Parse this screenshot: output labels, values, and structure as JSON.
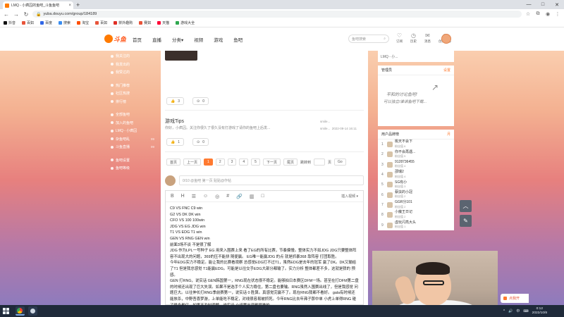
{
  "browser": {
    "tab_title": "LMQ - 小疯囚的鱼吧_斗鱼鱼吧",
    "close_glyph": "×",
    "new_tab_glyph": "+",
    "window_controls": [
      "—",
      "□",
      "✕"
    ],
    "url": "yuba.douyu.com/group/184189",
    "bookmarks": [
      {
        "label": "抖音",
        "color": "#111111"
      },
      {
        "label": "百如",
        "color": "#e8543a"
      },
      {
        "label": "百度",
        "color": "#3066e6"
      },
      {
        "label": "搜索",
        "color": "#3a8df0"
      },
      {
        "label": "淘宝",
        "color": "#ff5000"
      },
      {
        "label": "百如",
        "color": "#e8543a"
      },
      {
        "label": "拼外趣购",
        "color": "#e02e24"
      },
      {
        "label": "赛如",
        "color": "#e8543a"
      },
      {
        "label": "天猫",
        "color": "#ff0036"
      },
      {
        "label": "游戏大全",
        "color": "#2fa84f"
      }
    ]
  },
  "site": {
    "logo_text": "斗鱼",
    "nav": [
      "首页",
      "直播",
      "分类▾",
      "视频",
      "游戏",
      "鱼吧"
    ],
    "search_placeholder": "鱼吧搜索",
    "search_icon": "⌕",
    "header_icons": [
      {
        "glyph": "♡",
        "label": "订阅"
      },
      {
        "glyph": "◷",
        "label": "历史"
      },
      {
        "glyph": "✉",
        "label": "消息"
      },
      {
        "glyph": "☺",
        "label": "创作中心"
      }
    ]
  },
  "left_nav": {
    "group1": [
      "我关注的",
      "我发出的",
      "我赞过的"
    ],
    "group2": [
      "热门推荐",
      "社区热搜",
      "排行榜"
    ],
    "group3": [
      {
        "label": "全部鱼吧",
        "count": ""
      },
      {
        "label": "加入的鱼吧",
        "count": ""
      },
      {
        "label": "LMQ - 小疯囚",
        "count": ""
      },
      {
        "label": "杂鱼吧乱",
        "count": "99"
      },
      {
        "label": "斗鱼直播",
        "count": "99"
      }
    ],
    "group4": [
      "鱼吧设置",
      "鱼吧等级"
    ]
  },
  "main": {
    "like_icon": "👍",
    "comment_icon": "⊙",
    "post1": {
      "likes": "3",
      "comments": "0"
    },
    "post2": {
      "title": "游戏Tips",
      "subtitle": "你好，小疯囚。关注你很久了很久没有打游戏了请你的鱼吧上后发...",
      "author": "smile...",
      "author2": "smile...",
      "time": "2022-09-14 16:11",
      "likes": "1",
      "comments": "0"
    },
    "pager": {
      "home": "首页",
      "prev": "上一页",
      "pages": [
        "1",
        "2",
        "3",
        "4",
        "5"
      ],
      "next": "下一页",
      "last": "尾页",
      "jump": "跳转到",
      "page_unit": "页",
      "go": "Go"
    },
    "reply_hint": "0/10 @鱼吧 第一页 贴贴@作帖",
    "editor_tools": [
      "B",
      "H",
      "☰",
      "☺",
      "◎",
      "#",
      "🔗",
      "▥",
      "□"
    ],
    "editor_mode": "插入视频 ▾",
    "editor_lines": [
      "C9 VS FNC   C9 win",
      "G2 VS DK     DK win",
      "CFO VS 100    100win",
      "JDG VS EG    JDG  win",
      "T1   VS  EDG   T1 win",
      "GEN VS RNG    GEN  win",
      "前面3场不谈  不是很了解",
      "JDG 作为LPL一号种子  EG 用来入围赛上来  看了EG的所有比赛，节奏偏慢。整体实力不如JDG  JDG只要整体阵容不出现大的问题，369的压不能拼  随便赢。   EG唯一能赢JDG 的点 就是抓暴368  靠阵容 打团取胜。",
      "今年EDG实力不稳定。能让我的比赛看观察 总感觉EDG打不过T1，虽然EDG是去年的冠军 赢了DK。DK又输给了T1 但是我总感觉 T1能赢EDG。可能是以往交手EDG大部分都输了。实力分析 整体都差不多，这就是猜的  预感。",
      "GEN 打RNG，说实话  GEN韩国第一，RNG现在状态很不稳定。能够拍日本赛区DFM一场。甚至在打DFM第二盘的时候还出现了巨大失误。如果不是选手个人实力稳住，第二盘也要输。RNG虽然入围赛出线了，但是我感觉 问题巨大。以往伸长打RNG季前赛第一，说实话 0 胜算。真感觉完赢不了。现在RNG我都不看好。  gala有时候还能放杀，中野吾喜梦游，上单能吃不稳定，对线很容易被抓死。今年RNG比去年弗子那中单 小虎上单得RNG 碰了很多都亿。如果不及时调整，说实话 小组赛出现都很难的。"
    ]
  },
  "right": {
    "topline": "LMQ - 小...",
    "notice_title": "管理员",
    "notice_action": "设置",
    "notice_line1": "平和的讨论鱼吧!",
    "notice_line2": "可以独立/谁讲鱼吧下载...",
    "notice_glyph": "↗",
    "fans_title": "用户品牌榜",
    "fans_action": "月",
    "fans": [
      {
        "rank": "1",
        "name": "桃天不会下",
        "level": "粉丝值 6"
      },
      {
        "rank": "2",
        "name": "你不会再遇...",
        "level": "粉丝值 5"
      },
      {
        "rank": "3",
        "name": "9128736455",
        "level": "粉丝值 4"
      },
      {
        "rank": "4",
        "name": "邵瑞2",
        "level": "粉丝值 4"
      },
      {
        "rank": "5",
        "name": "SG有小",
        "level": "粉丝值 3"
      },
      {
        "rank": "6",
        "name": "蔡扶的小冠",
        "level": "粉丝值 2"
      },
      {
        "rank": "7",
        "name": "GGR分101",
        "level": "粉丝值 2"
      },
      {
        "rank": "8",
        "name": "小魔王日记",
        "level": "粉丝值 2"
      },
      {
        "rank": "9",
        "name": "虚玩闪亮大头",
        "level": "粉丝值 1"
      }
    ]
  },
  "floating": {
    "up": "︿",
    "edit": "✎",
    "open_label": "点我开"
  },
  "taskbar": {
    "tray_icons": [
      "^",
      "🔊",
      "中",
      "⌨"
    ],
    "time": "0:12",
    "date": "2022/10/8"
  }
}
